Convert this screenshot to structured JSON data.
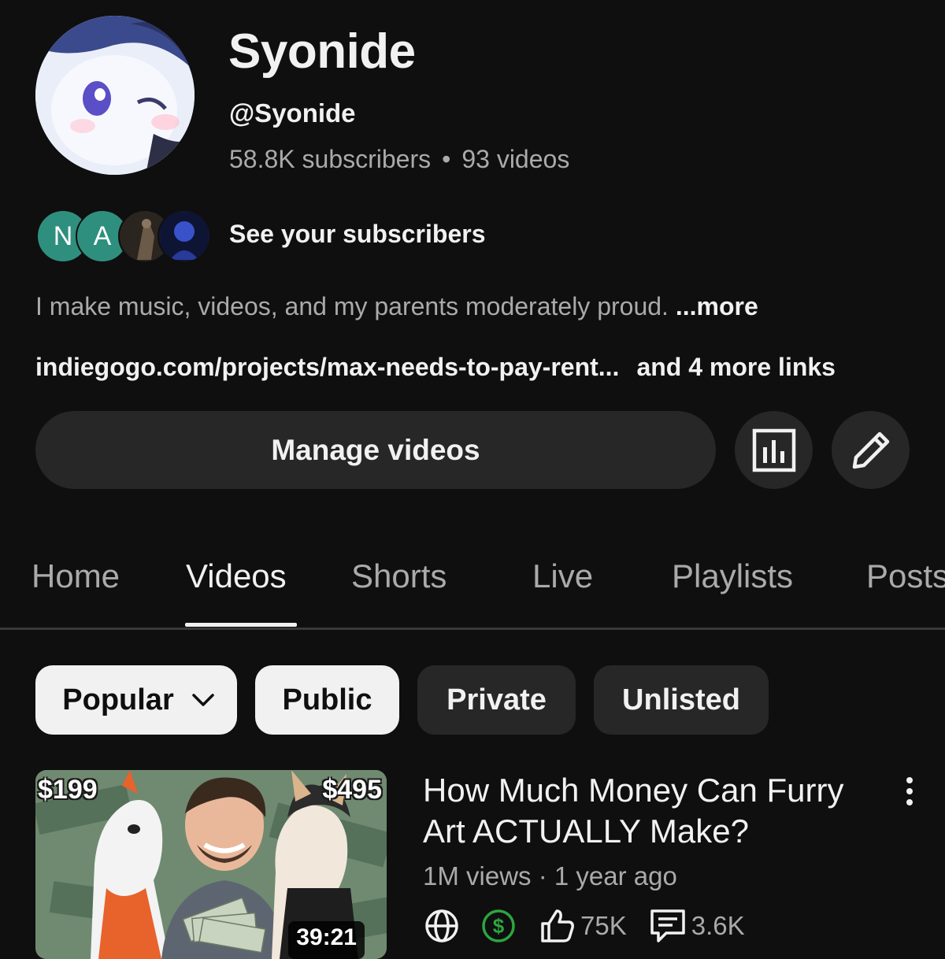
{
  "channel": {
    "name": "Syonide",
    "handle": "@Syonide",
    "subscribers": "58.8K subscribers",
    "separator": "•",
    "videos": "93 videos"
  },
  "subscribers_preview": {
    "avatars": [
      {
        "letter": "N",
        "color": "#2f8f7e"
      },
      {
        "letter": "A",
        "color": "#2f8f7e"
      }
    ],
    "label": "See your subscribers"
  },
  "description": {
    "text": "I make music, videos, and my parents moderately proud.",
    "more": "...more"
  },
  "links": {
    "primary": "indiegogo.com/projects/max-needs-to-pay-rent...",
    "more": "and 4 more links"
  },
  "actions": {
    "manage_videos": "Manage videos",
    "analytics_icon": "bar-chart-icon",
    "edit_icon": "pencil-icon"
  },
  "tabs": [
    {
      "label": "Home",
      "active": false
    },
    {
      "label": "Videos",
      "active": true
    },
    {
      "label": "Shorts",
      "active": false
    },
    {
      "label": "Live",
      "active": false
    },
    {
      "label": "Playlists",
      "active": false
    },
    {
      "label": "Posts",
      "active": false
    }
  ],
  "filters": {
    "sort": "Popular",
    "chips": [
      "Public",
      "Private",
      "Unlisted"
    ],
    "selected": "Public"
  },
  "videos": [
    {
      "title": "How Much Money Can Furry Art ACTUALLY Make?",
      "views": "1M views",
      "meta_sep": "·",
      "age": "1 year ago",
      "duration": "39:21",
      "thumb_price_left": "$199",
      "thumb_price_right": "$495",
      "likes": "75K",
      "comments": "3.6K",
      "visibility_icon": "globe-icon",
      "monetization_icon": "dollar-icon",
      "monetization_color": "#2ba640"
    }
  ],
  "colors": {
    "background": "#0f0f0f",
    "surface": "#272727",
    "text_primary": "#f1f1f1",
    "text_secondary": "#aaaaaa"
  }
}
